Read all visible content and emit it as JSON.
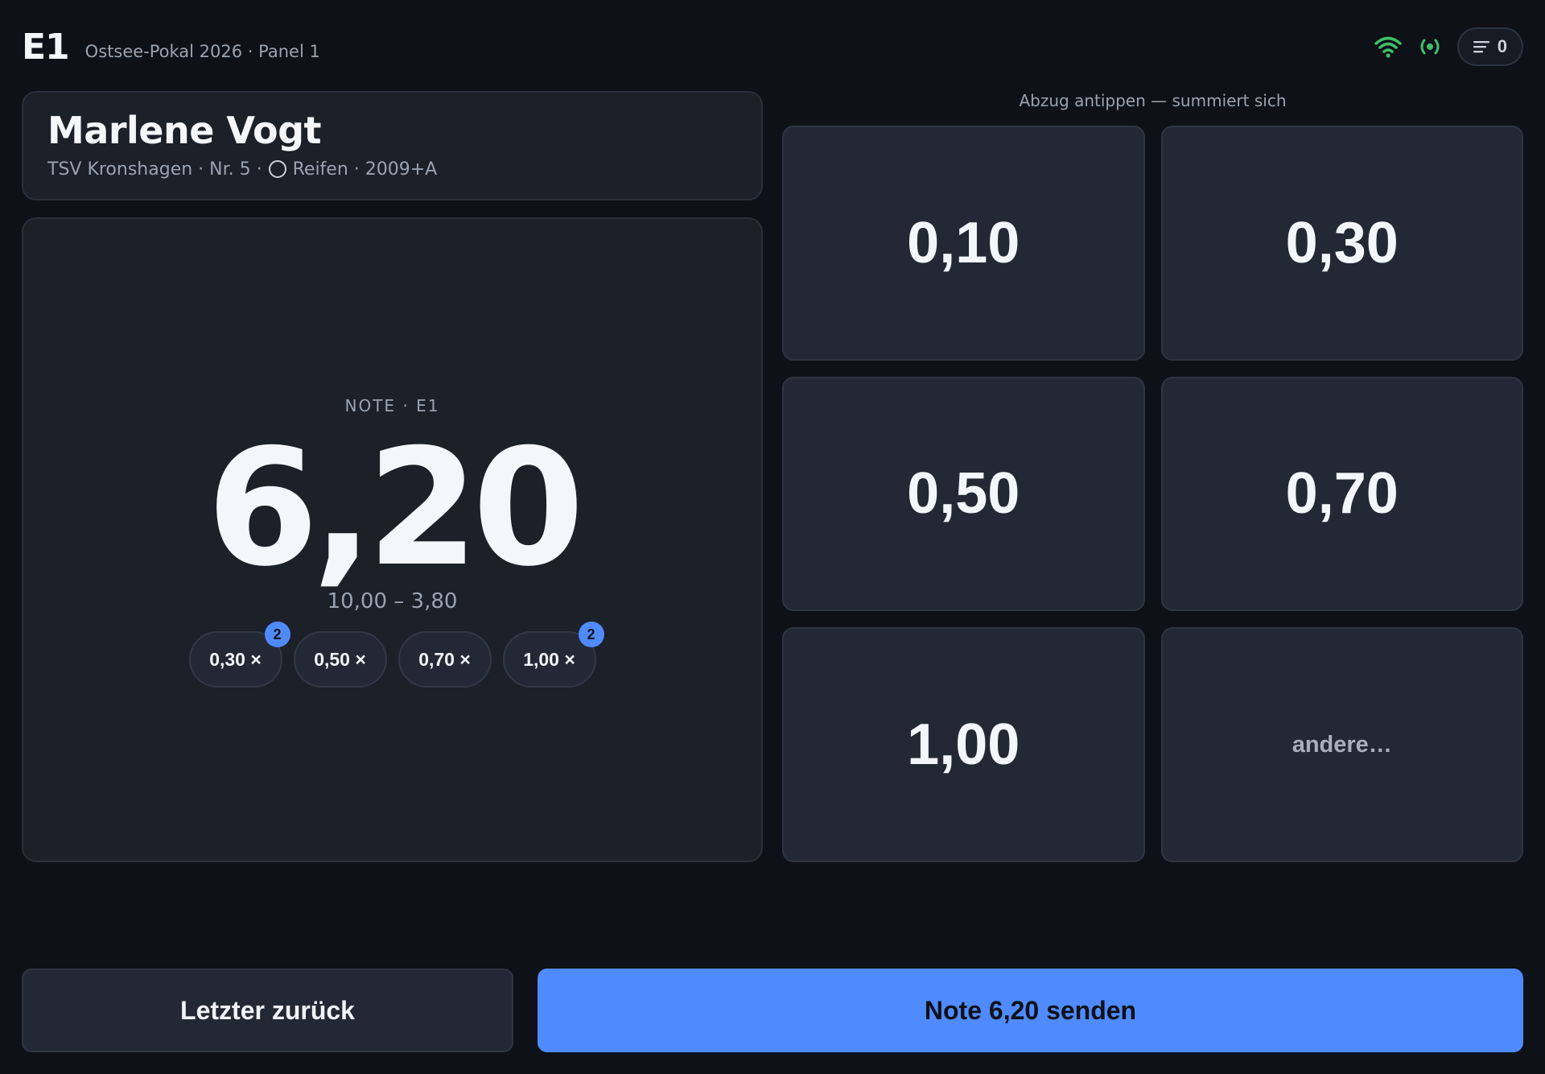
{
  "header": {
    "panel_code": "E1",
    "event": "Ostsee-Pokal 2026 · Panel 1",
    "queue_count": "0",
    "wifi_icon": "wifi-icon",
    "live_icon": "broadcast-icon",
    "queue_icon": "list-icon",
    "status_color": "#3fbf6b"
  },
  "athlete": {
    "name": "Marlene Vogt",
    "club_meta": "TSV Kronshagen · Nr. 5 ·",
    "apparatus_icon": "hoop-icon",
    "apparatus_meta": "Reifen · 2009+A"
  },
  "score": {
    "label": "NOTE · E1",
    "value": "6,20",
    "formula": "10,00 – 3,80"
  },
  "chips": [
    {
      "label": "0,30 ×",
      "count": "2"
    },
    {
      "label": "0,50 ×",
      "count": ""
    },
    {
      "label": "0,70 ×",
      "count": ""
    },
    {
      "label": "1,00 ×",
      "count": "2"
    }
  ],
  "grid": {
    "hint": "Abzug antippen — summiert sich",
    "buttons": [
      "0,10",
      "0,30",
      "0,50",
      "0,70",
      "1,00",
      "andere…"
    ]
  },
  "actions": {
    "undo": "Letzter zurück",
    "send": "Note 6,20 senden"
  },
  "colors": {
    "accent": "#4f8bff",
    "background": "#0e1117",
    "card": "#1b2029"
  }
}
